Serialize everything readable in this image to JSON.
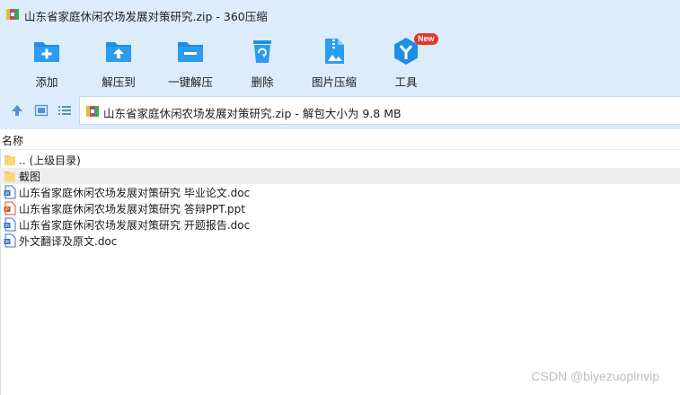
{
  "window": {
    "title": "山东省家庭休闲农场发展对策研究.zip - 360压缩",
    "icon": "zip-archive-icon"
  },
  "toolbar": {
    "items": [
      {
        "label": "添加",
        "icon": "add-folder-icon"
      },
      {
        "label": "解压到",
        "icon": "extract-to-folder-icon"
      },
      {
        "label": "一键解压",
        "icon": "one-click-extract-icon"
      },
      {
        "label": "删除",
        "icon": "recycle-bin-icon"
      },
      {
        "label": "图片压缩",
        "icon": "image-compress-icon"
      },
      {
        "label": "工具",
        "icon": "tools-icon",
        "badge": "New"
      }
    ],
    "accent_color": "#1b8fe6"
  },
  "nav": {
    "up_icon": "arrow-up-icon",
    "view_icon": "thumbnail-view-icon",
    "list_icon": "list-view-icon",
    "address": "山东省家庭休闲农场发展对策研究.zip - 解包大小为 9.8 MB"
  },
  "file_list": {
    "column_header": "名称",
    "rows": [
      {
        "name": ".. (上级目录)",
        "type": "folder"
      },
      {
        "name": "截图",
        "type": "folder",
        "selected": true
      },
      {
        "name": "山东省家庭休闲农场发展对策研究 毕业论文.doc",
        "type": "doc"
      },
      {
        "name": "山东省家庭休闲农场发展对策研究 答辩PPT.ppt",
        "type": "ppt"
      },
      {
        "name": "山东省家庭休闲农场发展对策研究 开题报告.doc",
        "type": "doc"
      },
      {
        "name": "外文翻译及原文.doc",
        "type": "doc"
      }
    ]
  },
  "watermark": "CSDN @biyezuopinvip"
}
